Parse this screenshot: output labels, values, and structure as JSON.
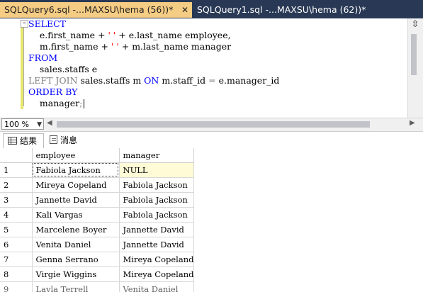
{
  "tabs": [
    {
      "label": "SQLQuery6.sql -...MAXSU\\hema (56))*",
      "close": "✕"
    },
    {
      "label": "SQLQuery1.sql -...MAXSU\\hema (62))*"
    }
  ],
  "editor": {
    "fold_symbol": "−",
    "lines": {
      "l1": {
        "kw": "SELECT"
      },
      "l2": {
        "a": "e.first_name + ",
        "s": "' '",
        "b": " + e.last_name employee,"
      },
      "l3": {
        "a": "m.first_name + ",
        "s": "' '",
        "b": " + m.last_name manager"
      },
      "l4": {
        "kw": "FROM"
      },
      "l5": {
        "a": "sales.staffs e"
      },
      "l6": {
        "g": "LEFT JOIN",
        "a": " sales.staffs m ",
        "k": "ON",
        "b": " m.staff_id ",
        "g2": "=",
        "c": " e.manager_id"
      },
      "l7": {
        "kw": "ORDER BY"
      },
      "l8": {
        "a": "manager",
        "g": ";"
      }
    }
  },
  "zoom": {
    "value": "100 %"
  },
  "results_tabs": {
    "results": "结果",
    "messages": "消息"
  },
  "grid": {
    "columns": [
      "employee",
      "manager"
    ],
    "rows": [
      {
        "n": "1",
        "employee": "Fabiola Jackson",
        "manager": "NULL"
      },
      {
        "n": "2",
        "employee": "Mireya Copeland",
        "manager": "Fabiola Jackson"
      },
      {
        "n": "3",
        "employee": "Jannette David",
        "manager": "Fabiola Jackson"
      },
      {
        "n": "4",
        "employee": "Kali Vargas",
        "manager": "Fabiola Jackson"
      },
      {
        "n": "5",
        "employee": "Marcelene Boyer",
        "manager": "Jannette David"
      },
      {
        "n": "6",
        "employee": "Venita Daniel",
        "manager": "Jannette David"
      },
      {
        "n": "7",
        "employee": "Genna Serrano",
        "manager": "Mireya Copeland"
      },
      {
        "n": "8",
        "employee": "Virgie Wiggins",
        "manager": "Mireya Copeland"
      },
      {
        "n": "9",
        "employee": "Layla Terrell",
        "manager": "Venita Daniel"
      }
    ]
  }
}
